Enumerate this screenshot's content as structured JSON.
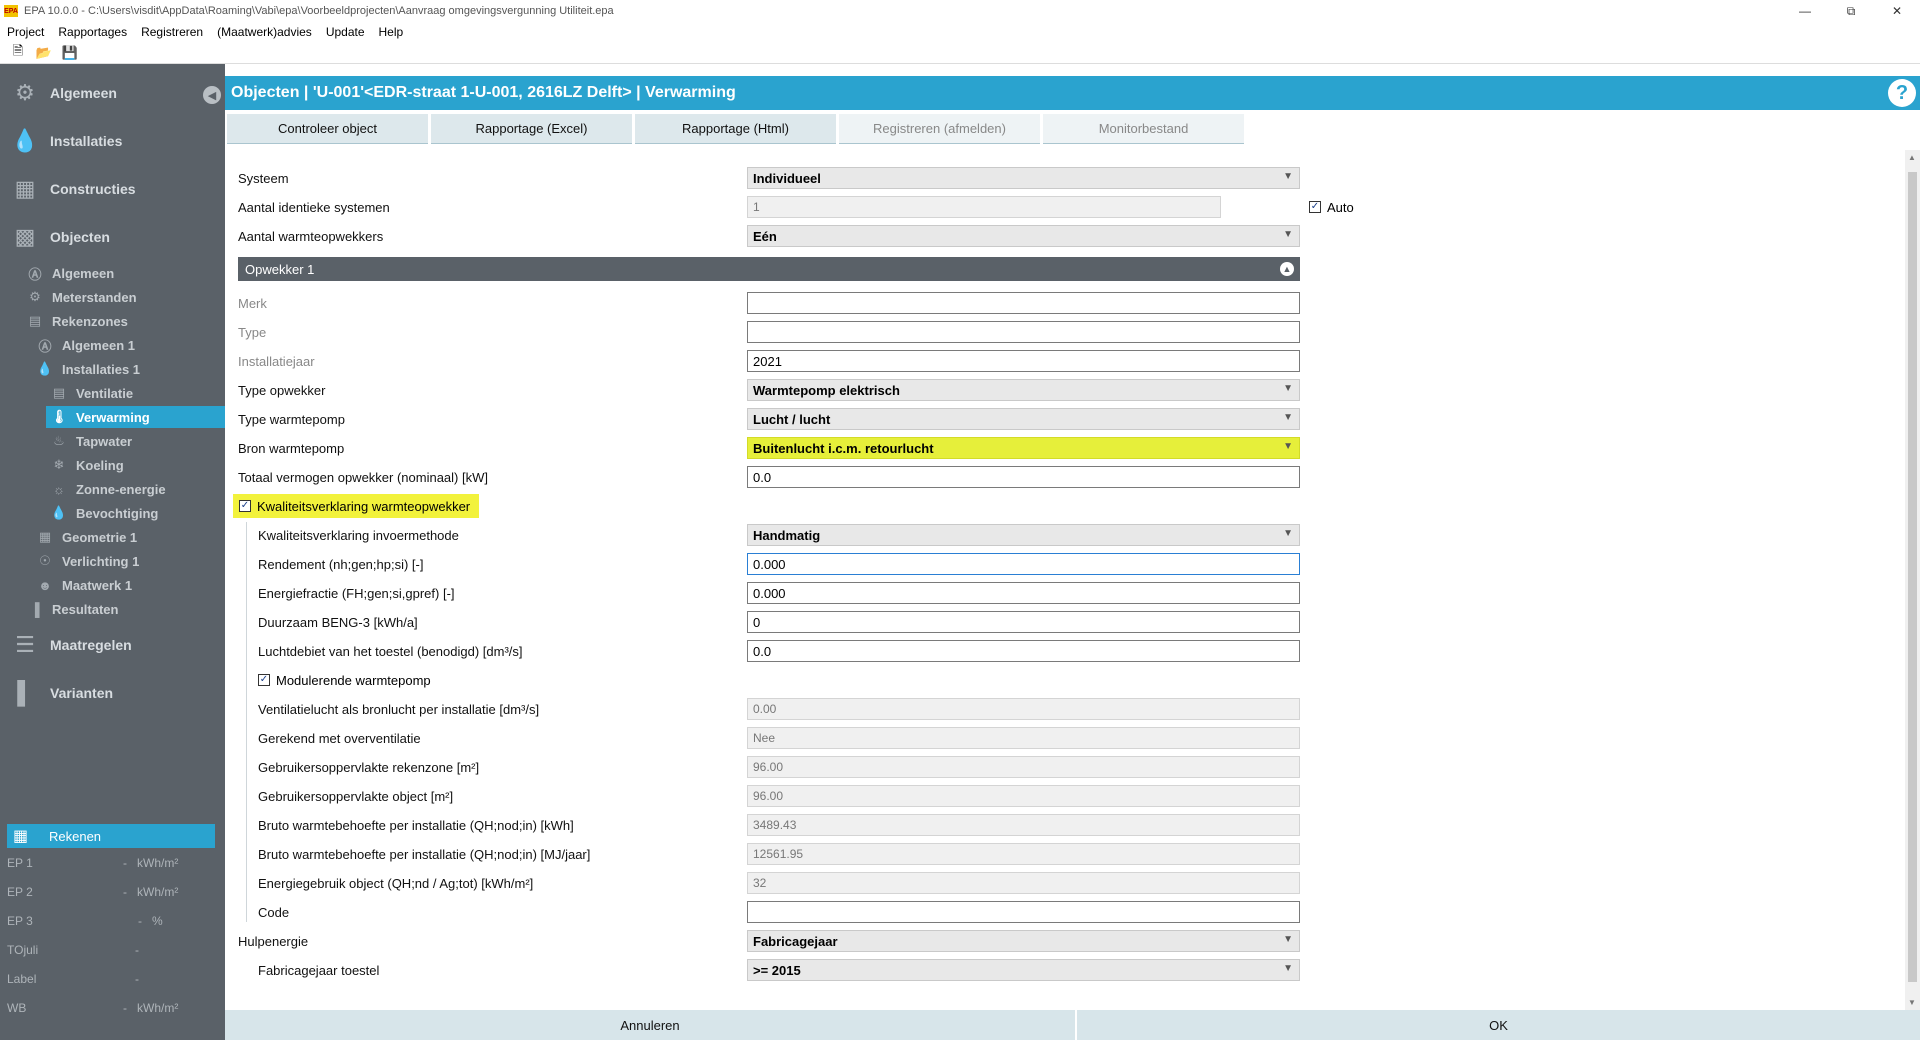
{
  "window": {
    "app_icon": "EPA",
    "title": "EPA 10.0.0 - C:\\Users\\visdit\\AppData\\Roaming\\Vabi\\epa\\Voorbeeldprojecten\\Aanvraag omgevingsvergunning Utiliteit.epa"
  },
  "menu": [
    "Project",
    "Rapportages",
    "Registreren",
    "(Maatwerk)advies",
    "Update",
    "Help"
  ],
  "toolbar_icons": [
    "new-file-icon",
    "open-folder-icon",
    "save-icon"
  ],
  "sidebar": {
    "main": [
      {
        "label": "Algemeen",
        "icon": "gear-icon"
      },
      {
        "label": "Installaties",
        "icon": "flame-icon"
      },
      {
        "label": "Constructies",
        "icon": "grid-icon"
      },
      {
        "label": "Objecten",
        "icon": "building-icon"
      }
    ],
    "tree": [
      {
        "label": "Algemeen",
        "icon": "letter-a-icon"
      },
      {
        "label": "Meterstanden",
        "icon": "meter-icon"
      },
      {
        "label": "Rekenzones",
        "icon": "zones-icon"
      },
      {
        "label": "Algemeen 1",
        "icon": "letter-a-icon"
      },
      {
        "label": "Installaties 1",
        "icon": "flame-icon"
      },
      {
        "label": "Ventilatie",
        "icon": "ventilation-icon"
      },
      {
        "label": "Verwarming",
        "icon": "thermometer-icon"
      },
      {
        "label": "Tapwater",
        "icon": "tap-icon"
      },
      {
        "label": "Koeling",
        "icon": "snowflake-icon"
      },
      {
        "label": "Zonne-energie",
        "icon": "sun-icon"
      },
      {
        "label": "Bevochtiging",
        "icon": "drop-icon"
      },
      {
        "label": "Geometrie 1",
        "icon": "geometry-icon"
      },
      {
        "label": "Verlichting 1",
        "icon": "bulb-icon"
      },
      {
        "label": "Maatwerk 1",
        "icon": "person-icon"
      },
      {
        "label": "Resultaten",
        "icon": "bar-chart-icon"
      }
    ],
    "main_bottom": [
      {
        "label": "Maatregelen",
        "icon": "list-icon"
      },
      {
        "label": "Varianten",
        "icon": "bar-chart-icon"
      }
    ],
    "rekenen": "Rekenen",
    "results": [
      {
        "label": "EP 1",
        "value": "-",
        "unit": "kWh/m²"
      },
      {
        "label": "EP 2",
        "value": "-",
        "unit": "kWh/m²"
      },
      {
        "label": "EP 3",
        "value": "-",
        "unit": "%"
      },
      {
        "label": "TOjuli",
        "value": "-",
        "unit": ""
      },
      {
        "label": "Label",
        "value": "-",
        "unit": ""
      },
      {
        "label": "WB",
        "value": "-",
        "unit": "kWh/m²"
      }
    ]
  },
  "header": {
    "title": "Objecten | 'U-001'<EDR-straat 1-U-001, 2616LZ Delft> | Verwarming",
    "help": "?"
  },
  "tabs": [
    {
      "label": "Controleer object",
      "enabled": true
    },
    {
      "label": "Rapportage (Excel)",
      "enabled": true
    },
    {
      "label": "Rapportage (Html)",
      "enabled": true
    },
    {
      "label": "Registreren (afmelden)",
      "enabled": false
    },
    {
      "label": "Monitorbestand",
      "enabled": false
    }
  ],
  "form": {
    "systeem": {
      "label": "Systeem",
      "value": "Individueel"
    },
    "aantal_identieke": {
      "label": "Aantal identieke systemen",
      "value": "1",
      "auto_label": "Auto",
      "auto_checked": true
    },
    "aantal_opwekkers": {
      "label": "Aantal warmteopwekkers",
      "value": "Eén"
    },
    "section": "Opwekker 1",
    "merk": {
      "label": "Merk",
      "value": ""
    },
    "type": {
      "label": "Type",
      "value": ""
    },
    "installatiejaar": {
      "label": "Installatiejaar",
      "value": "2021"
    },
    "type_opwekker": {
      "label": "Type opwekker",
      "value": "Warmtepomp elektrisch"
    },
    "type_warmtepomp": {
      "label": "Type warmtepomp",
      "value": "Lucht / lucht"
    },
    "bron_warmtepomp": {
      "label": "Bron warmtepomp",
      "value": "Buitenlucht i.c.m. retourlucht"
    },
    "totaal_vermogen": {
      "label": "Totaal vermogen opwekker (nominaal) [kW]",
      "value": "0.0"
    },
    "kwaliteitsverklaring": {
      "label": "Kwaliteitsverklaring warmteopwekker",
      "checked": true
    },
    "invoermethode": {
      "label": "Kwaliteitsverklaring invoermethode",
      "value": "Handmatig"
    },
    "rendement": {
      "label": "Rendement (nh;gen;hp;si) [-]",
      "value": "0.000"
    },
    "energiefractie": {
      "label": "Energiefractie (FH;gen;si,gpref) [-]",
      "value": "0.000"
    },
    "duurzaam": {
      "label": "Duurzaam BENG-3 [kWh/a]",
      "value": "0"
    },
    "luchtdebiet": {
      "label": "Luchtdebiet van het toestel (benodigd) [dm³/s]",
      "value": "0.0"
    },
    "modulerend": {
      "label": "Modulerende warmtepomp",
      "checked": true
    },
    "ventilatielucht": {
      "label": "Ventilatielucht als bronlucht per installatie [dm³/s]",
      "value": "0.00"
    },
    "overventilatie": {
      "label": "Gerekend met overventilatie",
      "value": "Nee"
    },
    "opp_rekenzone": {
      "label": "Gebruikersoppervlakte rekenzone [m²]",
      "value": "96.00"
    },
    "opp_object": {
      "label": "Gebruikersoppervlakte object [m²]",
      "value": "96.00"
    },
    "bruto_kwh": {
      "label": "Bruto warmtebehoefte per installatie (QH;nod;in) [kWh]",
      "value": "3489.43"
    },
    "bruto_mj": {
      "label": "Bruto warmtebehoefte per installatie (QH;nod;in) [MJ/jaar]",
      "value": "12561.95"
    },
    "energiegebruik": {
      "label": "Energiegebruik object (QH;nd / Ag;tot) [kWh/m²]",
      "value": "32"
    },
    "code": {
      "label": "Code",
      "value": ""
    },
    "hulpenergie": {
      "label": "Hulpenergie",
      "value": "Fabricagejaar"
    },
    "fabricagejaar": {
      "label": "Fabricagejaar toestel",
      "value": ">= 2015"
    }
  },
  "buttons": {
    "cancel": "Annuleren",
    "ok": "OK"
  },
  "colors": {
    "accent": "#2aa3cf",
    "sidebar": "#5a6168",
    "highlight": "#e6ef3a"
  }
}
